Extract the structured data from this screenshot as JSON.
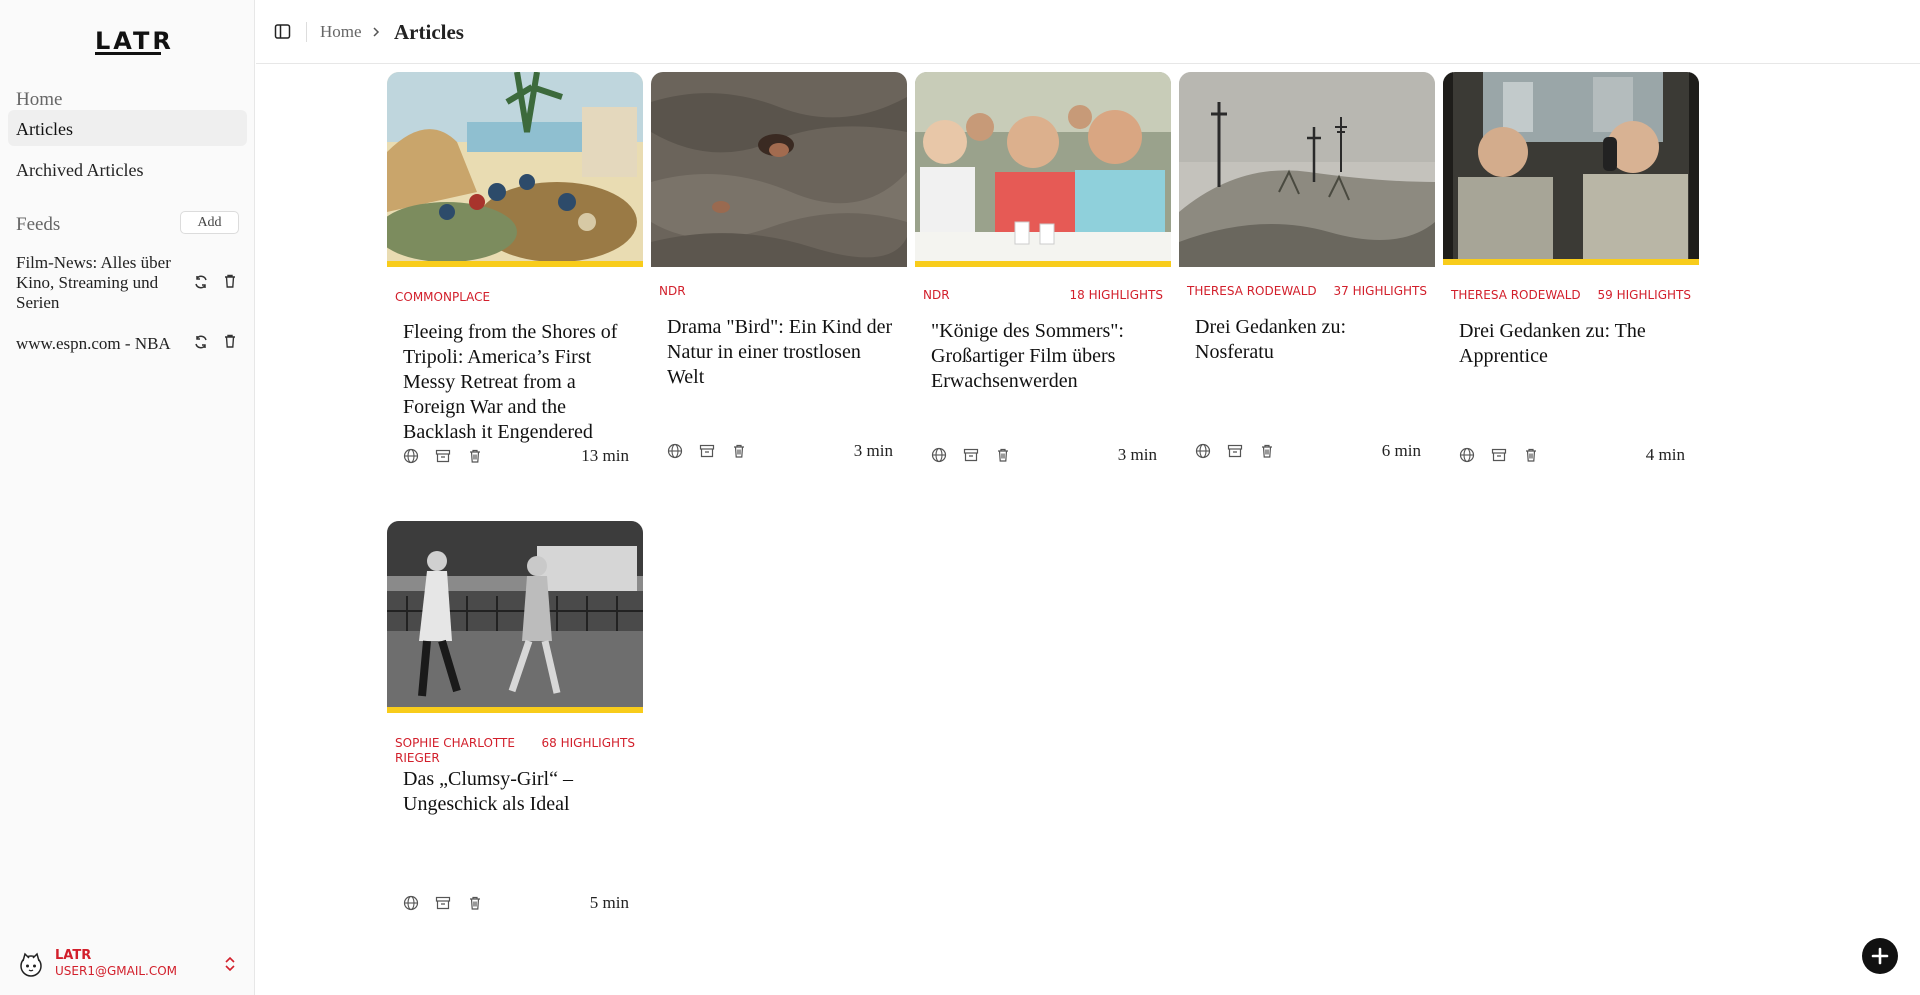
{
  "app": {
    "logo": "LATR"
  },
  "sidebar": {
    "nav": [
      {
        "label": "Home"
      },
      {
        "label": "Articles"
      },
      {
        "label": "Archived Articles"
      }
    ],
    "feeds_heading": "Feeds",
    "add_label": "Add",
    "feeds": [
      {
        "label": "Film-News: Alles über Kino, Streaming und Serien"
      },
      {
        "label": "www.espn.com - NBA"
      }
    ],
    "user": {
      "name": "LATR",
      "email": "USER1@GMAIL.COM"
    }
  },
  "header": {
    "breadcrumb": [
      {
        "label": "Home"
      },
      {
        "label": "Articles"
      }
    ]
  },
  "articles": [
    {
      "source": "COMMONPLACE",
      "highlights": "",
      "title": "Fleeing from the Shores of Tripoli: America’s First Messy Retreat from a Foreign War and the Backlash it Engendered",
      "read_time": "13 min"
    },
    {
      "source": "NDR",
      "highlights": "",
      "title": "Drama \"Bird\": Ein Kind der Natur in einer trostlosen Welt",
      "read_time": "3 min"
    },
    {
      "source": "NDR",
      "highlights": "18 HIGHLIGHTS",
      "title": "\"Könige des Sommers\": Großartiger Film übers Erwachsenwerden",
      "read_time": "3 min"
    },
    {
      "source": "THERESA RODEWALD",
      "highlights": "37 HIGHLIGHTS",
      "title": "Drei Gedanken zu: Nosferatu",
      "read_time": "6 min"
    },
    {
      "source": "THERESA RODEWALD",
      "highlights": "59 HIGHLIGHTS",
      "title": "Drei Gedanken zu: The Apprentice",
      "read_time": "4 min"
    },
    {
      "source": "SOPHIE CHARLOTTE RIEGER",
      "highlights": "68 HIGHLIGHTS",
      "title": "Das „Clumsy-Girl“ – Ungeschick als Ideal",
      "read_time": "5 min"
    }
  ],
  "colors": {
    "accent_red": "#d21f2b",
    "bar_yellow": "#f8cc1b"
  }
}
